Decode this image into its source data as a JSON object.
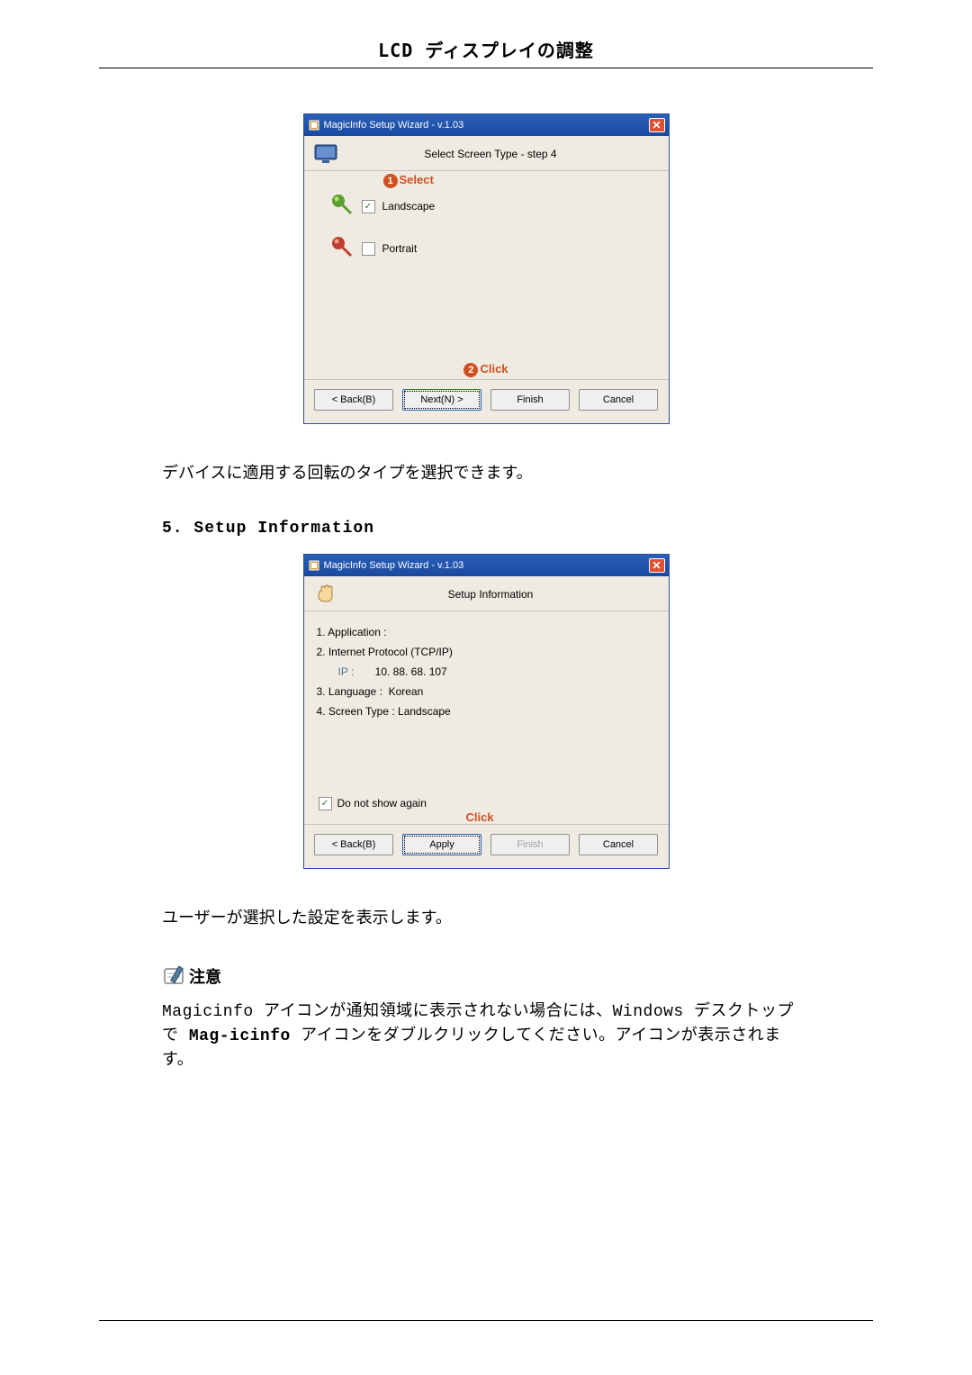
{
  "header_title": "LCD ディスプレイの調整",
  "dialog1": {
    "title": "MagicInfo Setup Wizard - v.1.03",
    "step_title": "Select Screen Type - step 4",
    "annot_select": "Select",
    "opt_landscape": "Landscape",
    "opt_portrait": "Portrait",
    "landscape_checked": "✓",
    "portrait_checked": "",
    "annot_click": "Click",
    "btn_back": "< Back(B)",
    "btn_next": "Next(N) >",
    "btn_finish": "Finish",
    "btn_cancel": "Cancel"
  },
  "text_rotate": "デバイスに適用する回転のタイプを選択できます。",
  "section5": "5. Setup Information",
  "dialog2": {
    "title": "MagicInfo Setup Wizard - v.1.03",
    "step_title": "Setup Information",
    "line1": "1. Application :",
    "line2": "2. Internet Protocol (TCP/IP)",
    "ip_label": "IP :",
    "ip_value": "10. 88. 68. 107",
    "line3_label": "3. Language :",
    "line3_value": "Korean",
    "line4_label": "4. Screen Type  :",
    "line4_value": "Landscape",
    "donotshow": "Do not show again",
    "donotshow_checked": "✓",
    "annot_click": "Click",
    "btn_back": "< Back(B)",
    "btn_apply": "Apply",
    "btn_finish": "Finish",
    "btn_cancel": "Cancel"
  },
  "text_showsettings": "ユーザーが選択した設定を表示します。",
  "note_label": "注意",
  "note_body_1": "Magicinfo  アイコンが通知領域に表示されない場合には、Windows デスクトップで ",
  "note_body_prod": "Mag-icinfo",
  "note_body_2": "  アイコンをダブルクリックしてください。アイコンが表示されます。"
}
